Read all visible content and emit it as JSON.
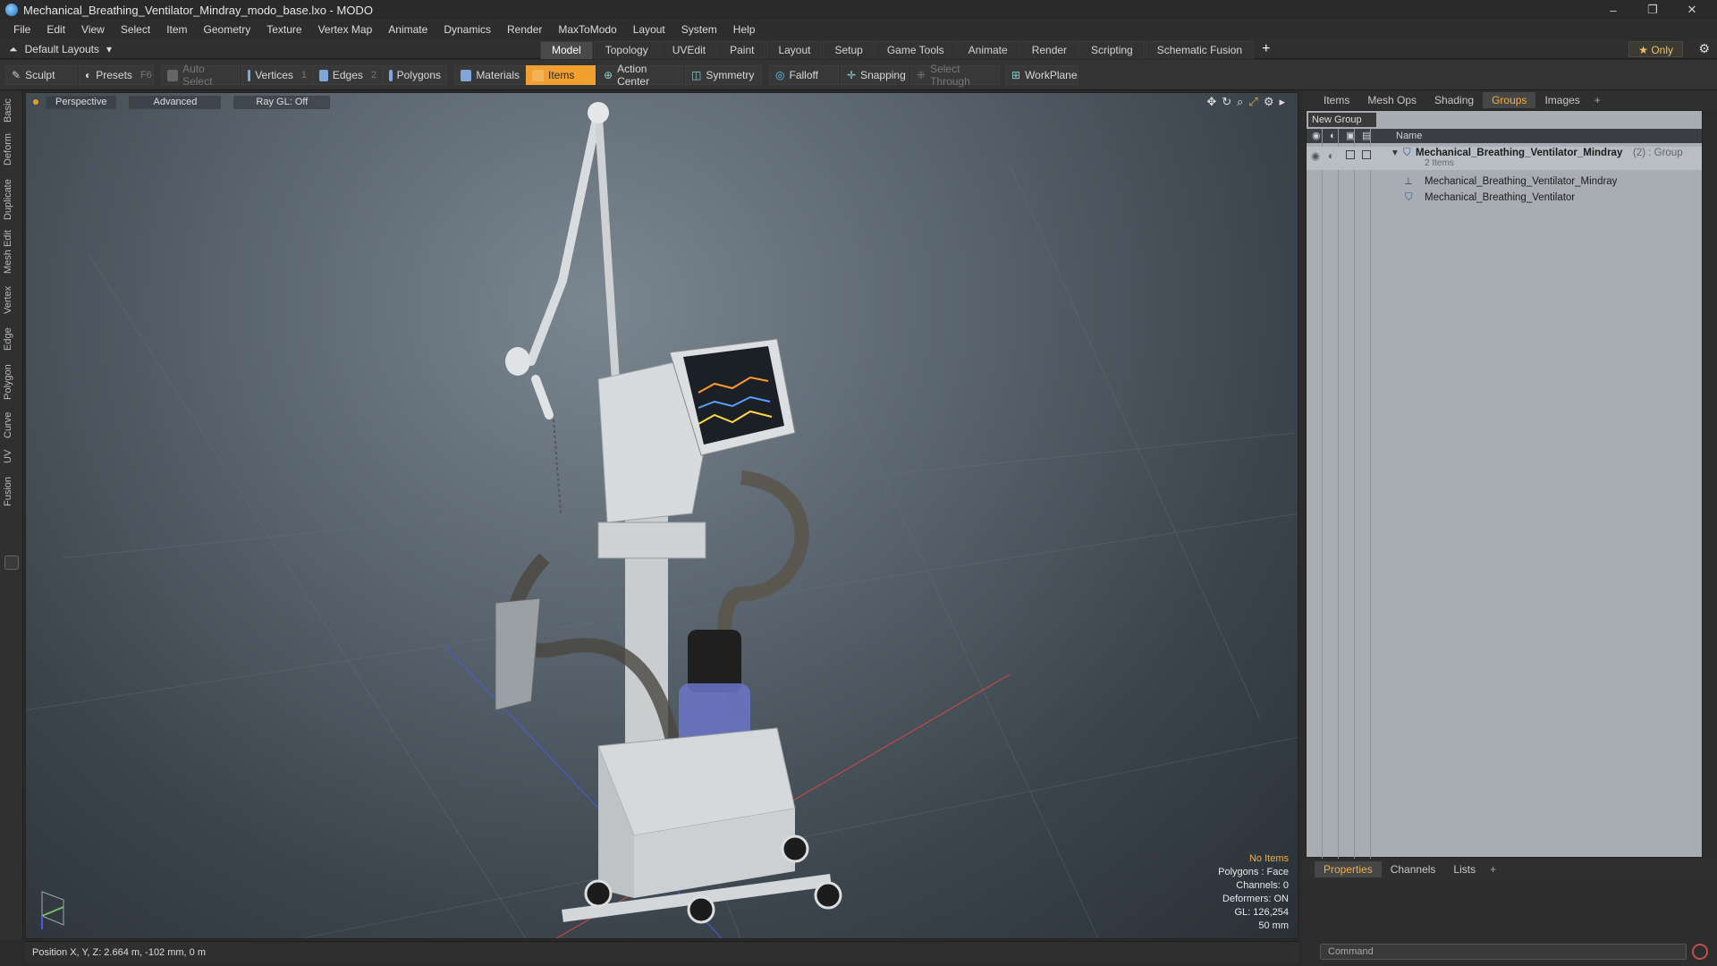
{
  "window": {
    "title": "Mechanical_Breathing_Ventilator_Mindray_modo_base.lxo - MODO",
    "controls": [
      "–",
      "❐",
      "✕"
    ]
  },
  "menu": [
    "File",
    "Edit",
    "View",
    "Select",
    "Item",
    "Geometry",
    "Texture",
    "Vertex Map",
    "Animate",
    "Dynamics",
    "Render",
    "MaxToModo",
    "Layout",
    "System",
    "Help"
  ],
  "layout_bar": {
    "layouts_label": "Default Layouts",
    "tabs": [
      "Model",
      "Topology",
      "UVEdit",
      "Paint",
      "Layout",
      "Setup",
      "Game Tools",
      "Animate",
      "Render",
      "Scripting",
      "Schematic Fusion"
    ],
    "active_tab": "Model",
    "only_label": "Only"
  },
  "toolbar": {
    "sculpt": "Sculpt",
    "presets": "Presets",
    "presets_key": "F6",
    "auto_select": "Auto Select",
    "vertices": "Vertices",
    "vertices_count": "1",
    "edges": "Edges",
    "edges_count": "2",
    "polygons": "Polygons",
    "materials": "Materials",
    "items": "Items",
    "action_center": "Action Center",
    "symmetry": "Symmetry",
    "falloff": "Falloff",
    "snapping": "Snapping",
    "select_through": "Select Through",
    "workplane": "WorkPlane"
  },
  "left_strip": [
    "Basic",
    "Deform",
    "Duplicate",
    "Mesh Edit",
    "Vertex",
    "Edge",
    "Polygon",
    "Curve",
    "UV",
    "Fusion"
  ],
  "viewport": {
    "view_mode": "Perspective",
    "shading": "Advanced",
    "raygl": "Ray GL: Off",
    "info": {
      "no_items": "No Items",
      "polygons": "Polygons : Face",
      "channels": "Channels: 0",
      "deformers": "Deformers: ON",
      "gl": "GL: 126,254",
      "focal": "50 mm"
    }
  },
  "status": {
    "position": "Position X, Y, Z:  2.664 m, -102 mm, 0 m"
  },
  "right_panel": {
    "tabs": [
      "Items",
      "Mesh Ops",
      "Shading",
      "Groups",
      "Images"
    ],
    "active_tab": "Groups",
    "new_group": "New Group",
    "column_name": "Name",
    "group_name": "Mechanical_Breathing_Ventilator_Mindray",
    "group_suffix": "(2) : Group",
    "group_count": "2 Items",
    "children": [
      "Mechanical_Breathing_Ventilator_Mindray",
      "Mechanical_Breathing_Ventilator"
    ],
    "bottom_tabs": [
      "Properties",
      "Channels",
      "Lists"
    ],
    "bottom_active": "Properties",
    "command_placeholder": "Command"
  },
  "colors": {
    "accent": "#f0a030",
    "background": "#2b2b2b",
    "panel_list": "#a7adb3"
  }
}
